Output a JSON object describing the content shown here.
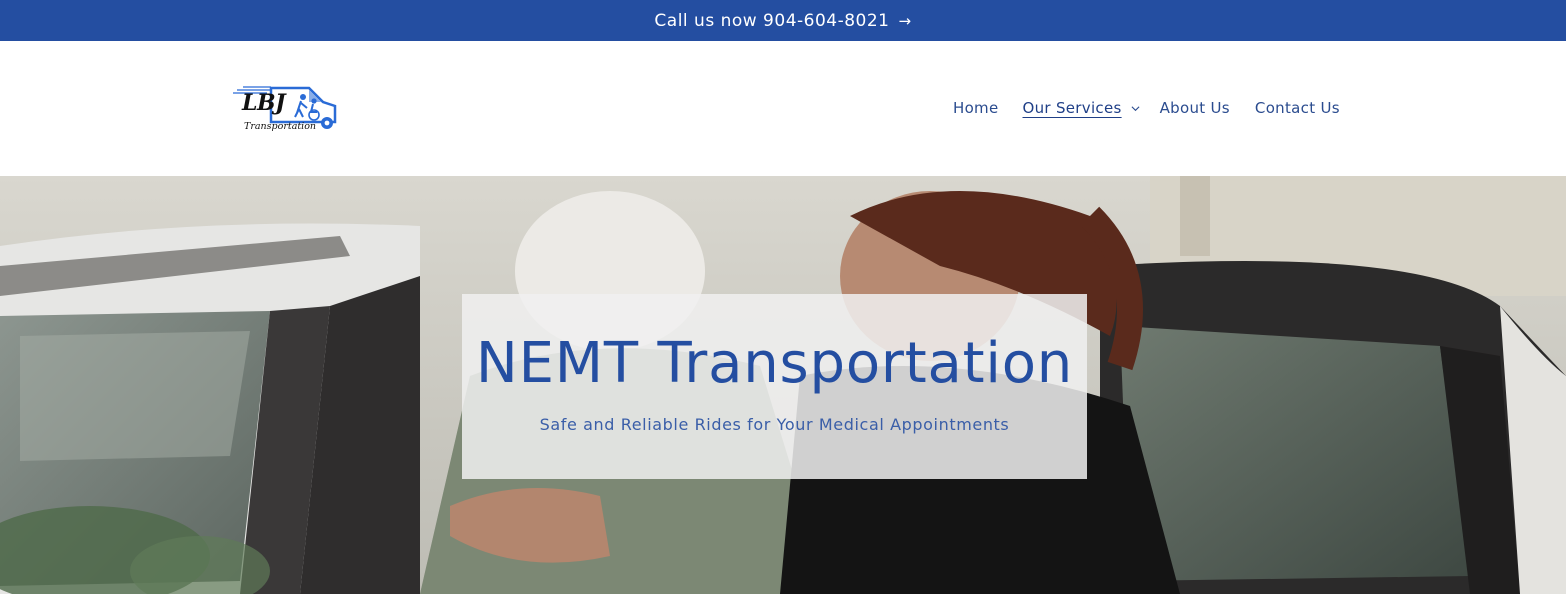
{
  "announcement": {
    "text": "Call us now 904-604-8021",
    "arrow": "→"
  },
  "logo": {
    "brand": "LBJ",
    "subtitle": "Transportation",
    "icon": "van-with-people-logo"
  },
  "nav": {
    "items": [
      {
        "label": "Home"
      },
      {
        "label": "Our Services",
        "active": true,
        "has_dropdown": true
      },
      {
        "label": "About Us"
      },
      {
        "label": "Contact Us"
      }
    ]
  },
  "hero": {
    "title": "NEMT Transportation",
    "subtitle": "Safe and Reliable Rides for Your Medical Appointments",
    "image": "caregiver-helping-elderly-woman-into-vehicle"
  },
  "colors": {
    "brand_blue": "#244ea1",
    "nav_text": "#2b4c8f"
  }
}
